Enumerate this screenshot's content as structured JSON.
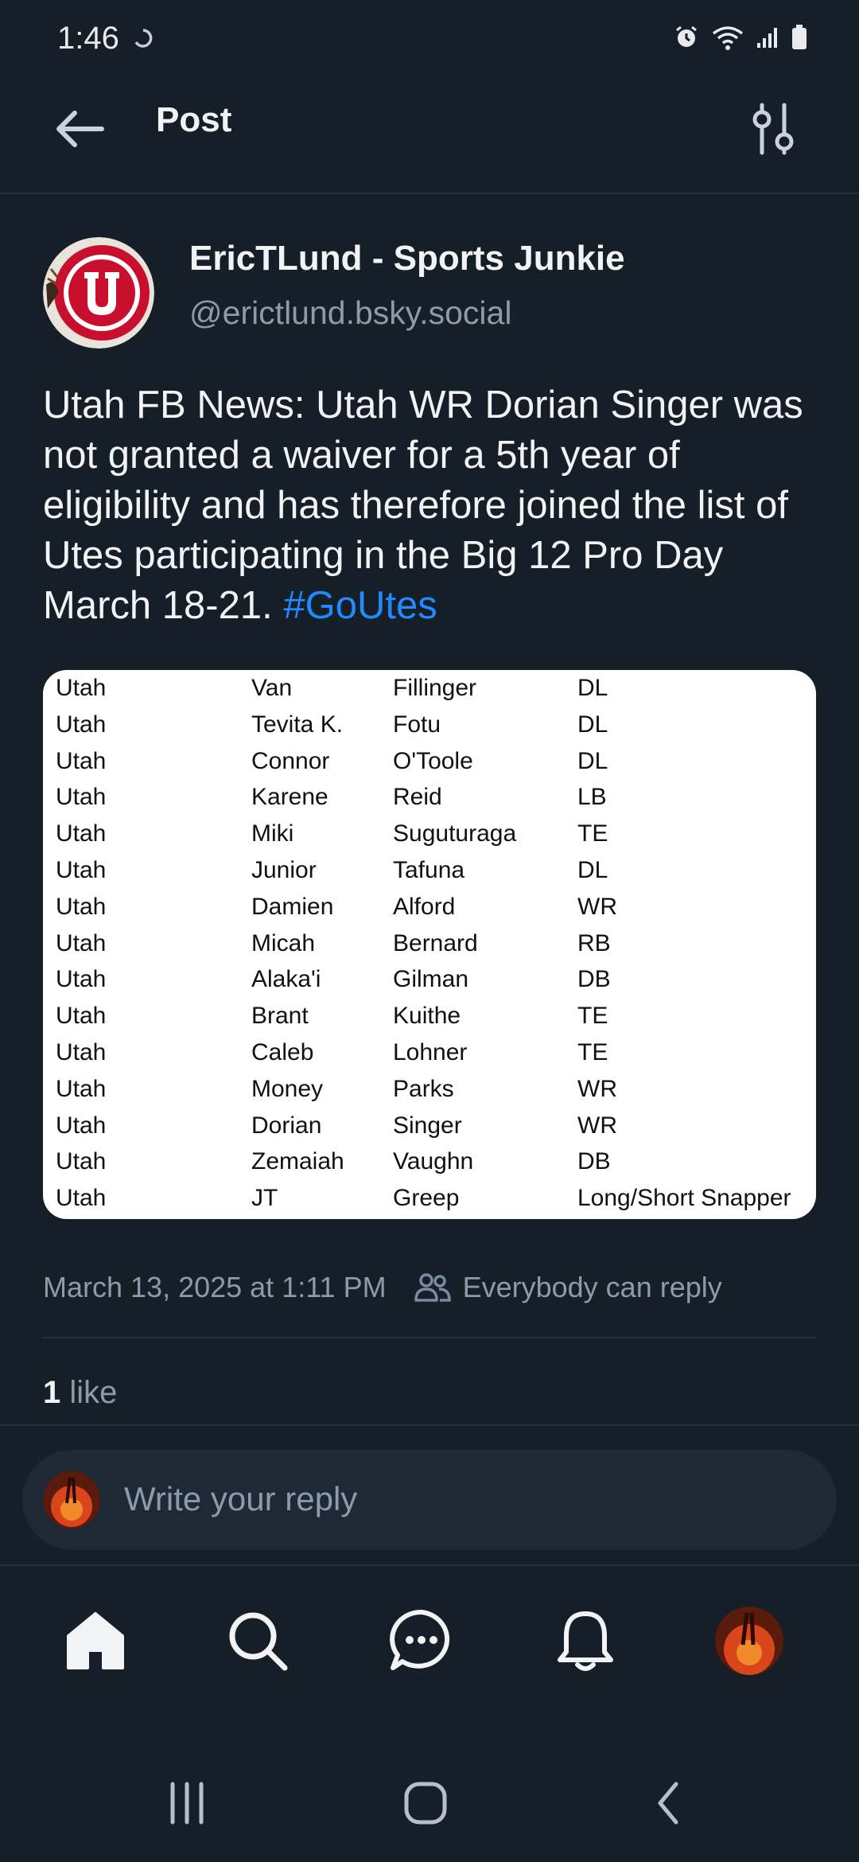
{
  "status_bar": {
    "time": "1:46"
  },
  "header": {
    "title": "Post"
  },
  "post": {
    "author_name": "EricTLund - Sports Junkie",
    "author_handle": "@erictlund.bsky.social",
    "text": "Utah FB News: Utah WR Dorian Singer was not granted a waiver for a 5th year of eligibility and has therefore joined the list of Utes participating in the Big 12 Pro Day March 18-21.",
    "hashtag": "#GoUtes",
    "image_table": [
      [
        "Utah",
        "Van",
        "Fillinger",
        "DL"
      ],
      [
        "Utah",
        "Tevita K.",
        "Fotu",
        "DL"
      ],
      [
        "Utah",
        "Connor",
        "O'Toole",
        "DL"
      ],
      [
        "Utah",
        "Karene",
        "Reid",
        "LB"
      ],
      [
        "Utah",
        "Miki",
        "Suguturaga",
        "TE"
      ],
      [
        "Utah",
        "Junior",
        "Tafuna",
        "DL"
      ],
      [
        "Utah",
        "Damien",
        "Alford",
        "WR"
      ],
      [
        "Utah",
        "Micah",
        "Bernard",
        "RB"
      ],
      [
        "Utah",
        "Alaka'i",
        "Gilman",
        "DB"
      ],
      [
        "Utah",
        "Brant",
        "Kuithe",
        "TE"
      ],
      [
        "Utah",
        "Caleb",
        "Lohner",
        "TE"
      ],
      [
        "Utah",
        "Money",
        "Parks",
        "WR"
      ],
      [
        "Utah",
        "Dorian",
        "Singer",
        "WR"
      ],
      [
        "Utah",
        "Zemaiah",
        "Vaughn",
        "DB"
      ],
      [
        "Utah",
        "JT",
        "Greep",
        "Long/Short Snapper"
      ]
    ],
    "date": "March 13, 2025 at 1:11 PM",
    "reply_setting": "Everybody can reply",
    "like_count": "1",
    "like_label": "like"
  },
  "reply": {
    "placeholder": "Write your reply"
  },
  "icons": {
    "back": "arrow-left-icon",
    "filter": "sliders-icon",
    "people": "people-icon",
    "nav": [
      "home-icon",
      "search-icon",
      "chat-icon",
      "bell-icon",
      "avatar"
    ],
    "system": [
      "recents-icon",
      "home-circle-icon",
      "back-chevron-icon"
    ]
  },
  "colors": {
    "background": "#161e27",
    "accent": "#208bfe",
    "muted": "#8d9aab",
    "reply_box": "#1e2936"
  }
}
